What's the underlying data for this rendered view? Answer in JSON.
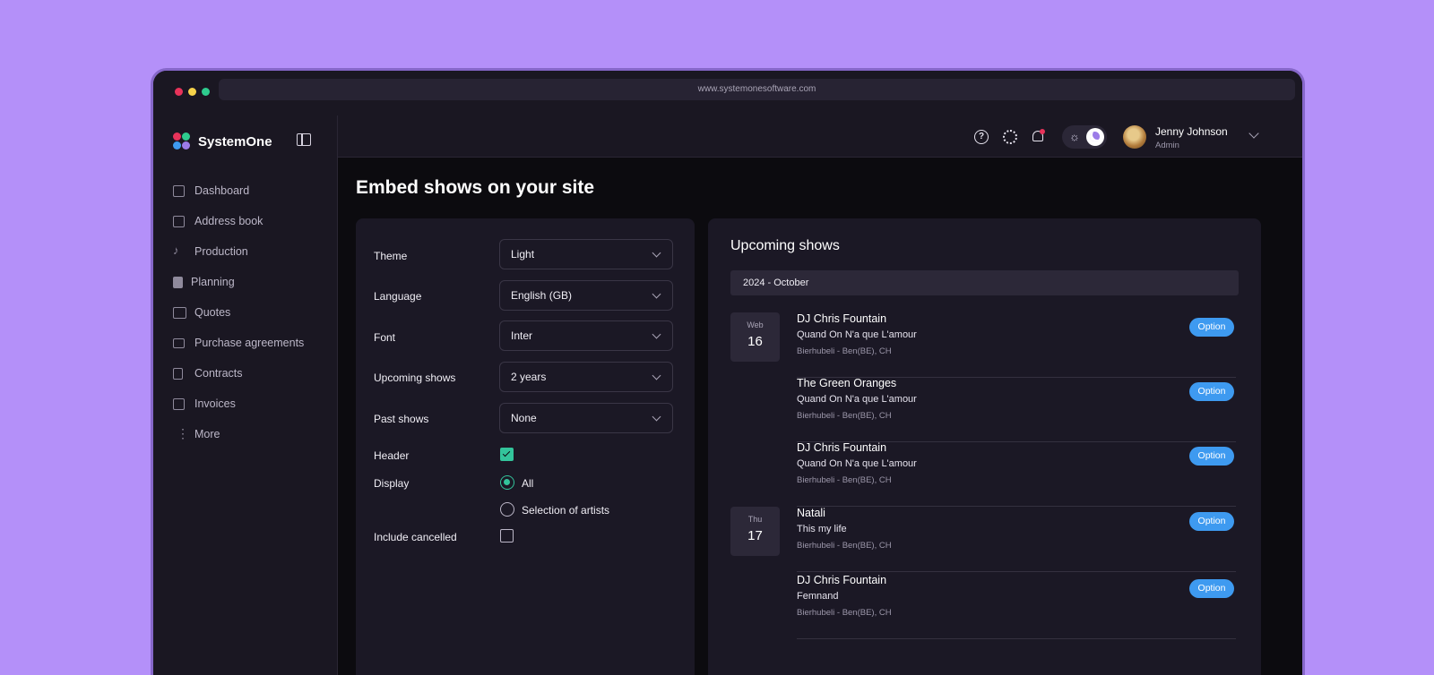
{
  "browser": {
    "url": "www.systemonesoftware.com"
  },
  "brand": {
    "name": "SystemOne",
    "logo_colors": [
      "#e8335a",
      "#2ecc8e",
      "#9b7be8",
      "#3e9af0"
    ]
  },
  "sidebar": {
    "items": [
      {
        "label": "Dashboard",
        "icon": "dashboard-icon"
      },
      {
        "label": "Address book",
        "icon": "address-book-icon"
      },
      {
        "label": "Production",
        "icon": "music-note-icon"
      },
      {
        "label": "Planning",
        "icon": "calendar-icon"
      },
      {
        "label": "Quotes",
        "icon": "book-icon"
      },
      {
        "label": "Purchase agreements",
        "icon": "mail-icon"
      },
      {
        "label": "Contracts",
        "icon": "document-icon"
      },
      {
        "label": "Invoices",
        "icon": "invoice-icon"
      },
      {
        "label": "More",
        "icon": "more-vertical-icon"
      }
    ]
  },
  "topbar": {
    "icons": [
      "help-icon",
      "settings-icon",
      "bell-icon"
    ],
    "user": {
      "name": "Jenny Johnson",
      "role": "Admin"
    }
  },
  "page": {
    "title": "Embed shows on your site"
  },
  "form": {
    "theme": {
      "label": "Theme",
      "value": "Light"
    },
    "language": {
      "label": "Language",
      "value": "English (GB)"
    },
    "font": {
      "label": "Font",
      "value": "Inter"
    },
    "upcoming": {
      "label": "Upcoming shows",
      "value": "2 years"
    },
    "past": {
      "label": "Past shows",
      "value": "None"
    },
    "header": {
      "label": "Header",
      "checked": true
    },
    "display": {
      "label": "Display",
      "options": [
        "All",
        "Selection of artists"
      ],
      "selected": "All"
    },
    "cancelled": {
      "label": "Include cancelled",
      "checked": false
    }
  },
  "upcoming": {
    "title": "Upcoming shows",
    "month": "2024 - October",
    "dates": [
      {
        "dow": "Web",
        "day": "16"
      },
      {
        "dow": "Thu",
        "day": "17"
      }
    ],
    "shows": [
      {
        "title": "DJ Chris Fountain",
        "sub": "Quand On N'a que L'amour",
        "loc": "Bierhubeli - Ben(BE), CH",
        "badge": "Option"
      },
      {
        "title": "The Green Oranges",
        "sub": "Quand On N'a que L'amour",
        "loc": "Bierhubeli - Ben(BE), CH",
        "badge": "Option"
      },
      {
        "title": "DJ Chris Fountain",
        "sub": "Quand On N'a que L'amour",
        "loc": "Bierhubeli - Ben(BE), CH",
        "badge": "Option"
      },
      {
        "title": "Natali",
        "sub": "This my life",
        "loc": "Bierhubeli - Ben(BE), CH",
        "badge": "Option"
      },
      {
        "title": "DJ Chris Fountain",
        "sub": "Femnand",
        "loc": "Bierhubeli - Ben(BE), CH",
        "badge": "Option"
      }
    ]
  },
  "colors": {
    "accent": "#33c49b",
    "badge": "#3e9af0",
    "background": "#b490f9"
  }
}
